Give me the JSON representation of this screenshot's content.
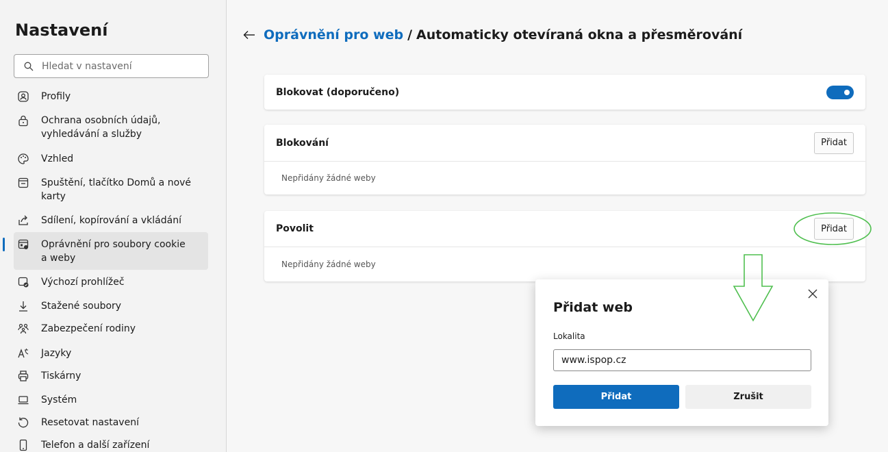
{
  "sidebar": {
    "title": "Nastavení",
    "search_placeholder": "Hledat v nastavení",
    "items": [
      {
        "label": "Profily",
        "icon": "profile-icon"
      },
      {
        "label": "Ochrana osobních údajů, vyhledávání a služby",
        "icon": "lock-icon"
      },
      {
        "label": "Vzhled",
        "icon": "palette-icon"
      },
      {
        "label": "Spuštění, tlačítko Domů a nové karty",
        "icon": "home-start-icon"
      },
      {
        "label": "Sdílení, kopírování a vkládání",
        "icon": "share-icon"
      },
      {
        "label": "Oprávnění pro soubory cookie a weby",
        "icon": "site-permissions-icon",
        "active": true
      },
      {
        "label": "Výchozí prohlížeč",
        "icon": "default-browser-icon"
      },
      {
        "label": "Stažené soubory",
        "icon": "download-icon"
      },
      {
        "label": "Zabezpečení rodiny",
        "icon": "family-icon"
      },
      {
        "label": "Jazyky",
        "icon": "language-icon"
      },
      {
        "label": "Tiskárny",
        "icon": "printer-icon"
      },
      {
        "label": "Systém",
        "icon": "system-icon"
      },
      {
        "label": "Resetovat nastavení",
        "icon": "reset-icon"
      },
      {
        "label": "Telefon a další zařízení",
        "icon": "phone-icon"
      }
    ]
  },
  "header": {
    "link": "Oprávnění pro web",
    "separator": "/",
    "current": "Automaticky otevíraná okna a přesměrování"
  },
  "cards": {
    "block_recommended": {
      "label": "Blokovat (doporučeno)",
      "toggle_on": true
    },
    "blocking": {
      "title": "Blokování",
      "add_label": "Přidat",
      "empty_text": "Nepřidány žádné weby"
    },
    "allow": {
      "title": "Povolit",
      "add_label": "Přidat",
      "empty_text": "Nepřidány žádné weby"
    }
  },
  "dialog": {
    "title": "Přidat web",
    "field_label": "Lokalita",
    "field_value": "www.ispop.cz",
    "primary_label": "Přidat",
    "secondary_label": "Zrušit"
  },
  "colors": {
    "accent": "#0f6cbd",
    "annotation": "#4fbf4f"
  }
}
